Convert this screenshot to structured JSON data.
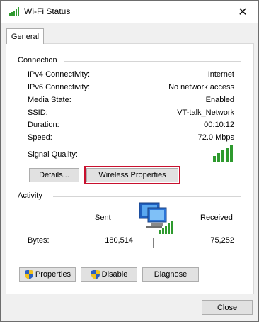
{
  "window": {
    "title": "Wi-Fi Status",
    "close_symbol": "✕"
  },
  "tabs": [
    {
      "label": "General"
    }
  ],
  "connection": {
    "heading": "Connection",
    "rows": [
      {
        "label": "IPv4 Connectivity:",
        "value": "Internet"
      },
      {
        "label": "IPv6 Connectivity:",
        "value": "No network access"
      },
      {
        "label": "Media State:",
        "value": "Enabled"
      },
      {
        "label": "SSID:",
        "value": "VT-talk_Network"
      },
      {
        "label": "Duration:",
        "value": "00:10:12"
      },
      {
        "label": "Speed:",
        "value": "72.0 Mbps"
      }
    ],
    "signal_label": "Signal Quality:",
    "signal_icon": "signal-bars-icon",
    "signal_bars_lit": 5,
    "signal_color": "#2e9a2e",
    "details_button": "Details...",
    "wireless_properties_button": "Wireless Properties",
    "highlight_color": "#c8102e"
  },
  "activity": {
    "heading": "Activity",
    "sent_label": "Sent",
    "received_label": "Received",
    "bytes_label": "Bytes:",
    "bytes_sent": "180,514",
    "bytes_received": "75,252",
    "network_icon": "network-computer-icon"
  },
  "buttons": {
    "properties": "Properties",
    "disable": "Disable",
    "diagnose": "Diagnose",
    "close": "Close"
  }
}
